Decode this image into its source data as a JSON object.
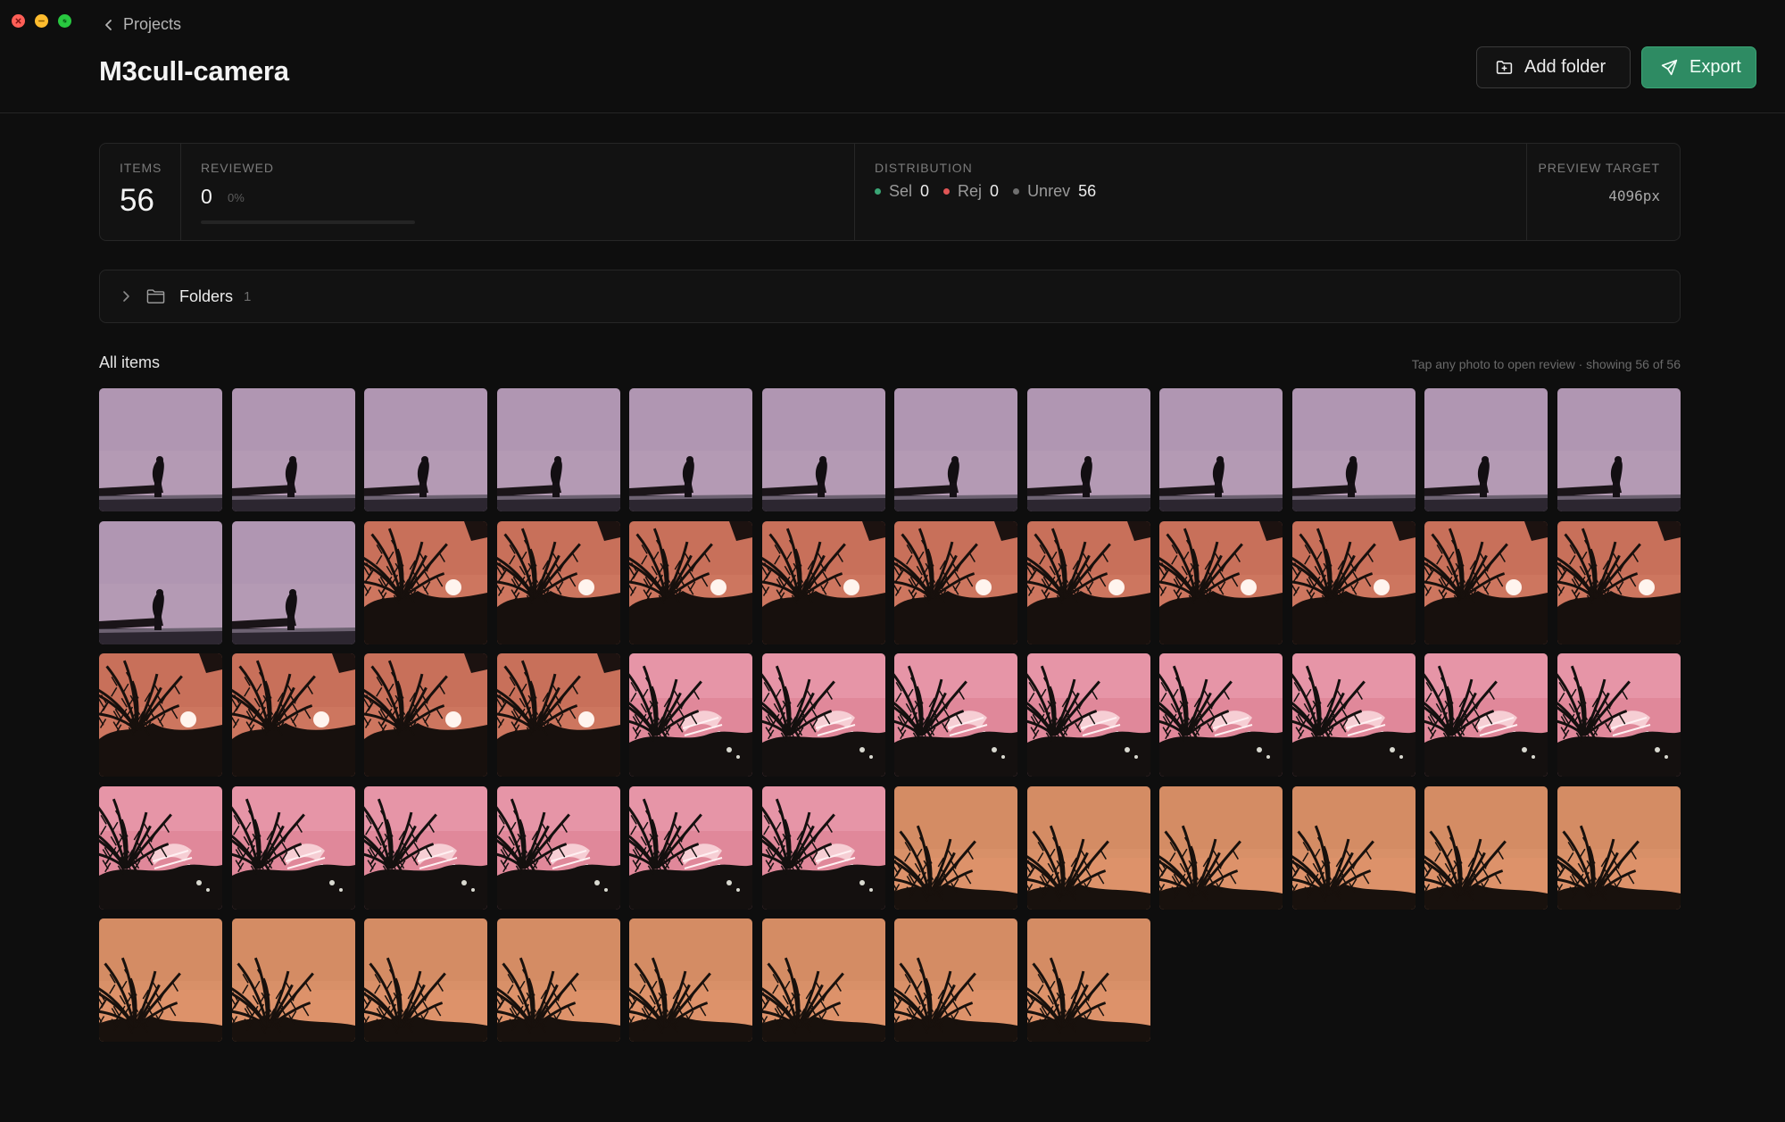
{
  "window": {
    "controls": [
      "close",
      "minimize",
      "maximize"
    ],
    "colors": {
      "close": "#ff5f57",
      "minimize": "#febc2e",
      "maximize": "#28c840"
    }
  },
  "header": {
    "breadcrumb": "Projects",
    "title": "M3cull-camera",
    "add_folder_label": "Add folder",
    "export_label": "Export",
    "accent": "#2e8b63"
  },
  "stats": {
    "items_label": "ITEMS",
    "items_value": "56",
    "reviewed_label": "REVIEWED",
    "reviewed_value": "0",
    "reviewed_pct": "0%",
    "reviewed_fraction": 0,
    "distribution_label": "DISTRIBUTION",
    "sel_label": "Sel",
    "sel_value": "0",
    "rej_label": "Rej",
    "rej_value": "0",
    "unrev_label": "Unrev",
    "unrev_value": "56",
    "colors": {
      "sel": "#3aa575",
      "rej": "#e05555",
      "unrev": "#6f6f6f"
    },
    "preview_label": "PREVIEW TARGET",
    "preview_value": "4096px"
  },
  "folders": {
    "label": "Folders",
    "count": "1"
  },
  "all_items": {
    "label": "All items",
    "hint": "Tap any photo to open review · showing 56 of 56"
  },
  "photos": [
    "bird",
    "bird",
    "bird",
    "bird",
    "bird",
    "bird",
    "bird",
    "bird",
    "bird",
    "bird",
    "bird",
    "bird",
    "bird",
    "bird",
    "palm_sun",
    "palm_sun",
    "palm_sun",
    "palm_sun",
    "palm_sun",
    "palm_sun",
    "palm_sun",
    "palm_sun",
    "palm_sun",
    "palm_sun",
    "palm_sun",
    "palm_sun",
    "palm_sun",
    "palm_sun",
    "palm_pink",
    "palm_pink",
    "palm_pink",
    "palm_pink",
    "palm_pink",
    "palm_pink",
    "palm_pink",
    "palm_pink",
    "palm_pink",
    "palm_pink",
    "palm_pink",
    "palm_pink",
    "palm_pink",
    "palm_pink",
    "orange_sky",
    "orange_sky",
    "orange_sky",
    "orange_sky",
    "orange_sky",
    "orange_sky",
    "orange_sky",
    "orange_sky",
    "orange_sky",
    "orange_sky",
    "orange_sky",
    "orange_sky",
    "orange_sky",
    "orange_sky"
  ]
}
